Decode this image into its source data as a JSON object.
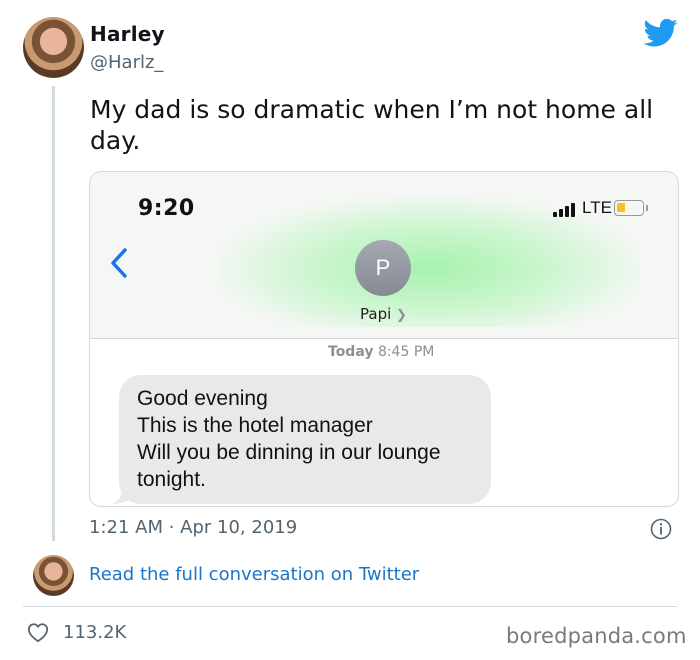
{
  "author": {
    "name": "Harley",
    "handle": "@Harlz_"
  },
  "tweet": {
    "text": "My dad is so dramatic when I’m not home all day.",
    "timestamp": "1:21 AM · Apr 10, 2019",
    "read_link": "Read the full conversation on Twitter",
    "likes": "113.2K"
  },
  "screenshot": {
    "status_time": "9:20",
    "network": "LTE",
    "contact_initial": "P",
    "contact_name": "Papi",
    "date_prefix": "Today",
    "date_time": "8:45 PM",
    "message_lines": [
      "Good evening",
      "This is the hotel manager",
      "Will you be dinning in our lounge",
      "tonight."
    ]
  },
  "watermark": "boredpanda.com",
  "colors": {
    "twitter_blue": "#1d9bf0",
    "link_blue": "#1b75c9",
    "ios_blue": "#1a73e8",
    "bubble_gray": "#e9e9eb",
    "battery_yellow": "#f2c318"
  },
  "icons": [
    "twitter-bird-icon",
    "back-chevron-icon",
    "info-icon",
    "heart-icon",
    "signal-icon",
    "battery-icon"
  ]
}
